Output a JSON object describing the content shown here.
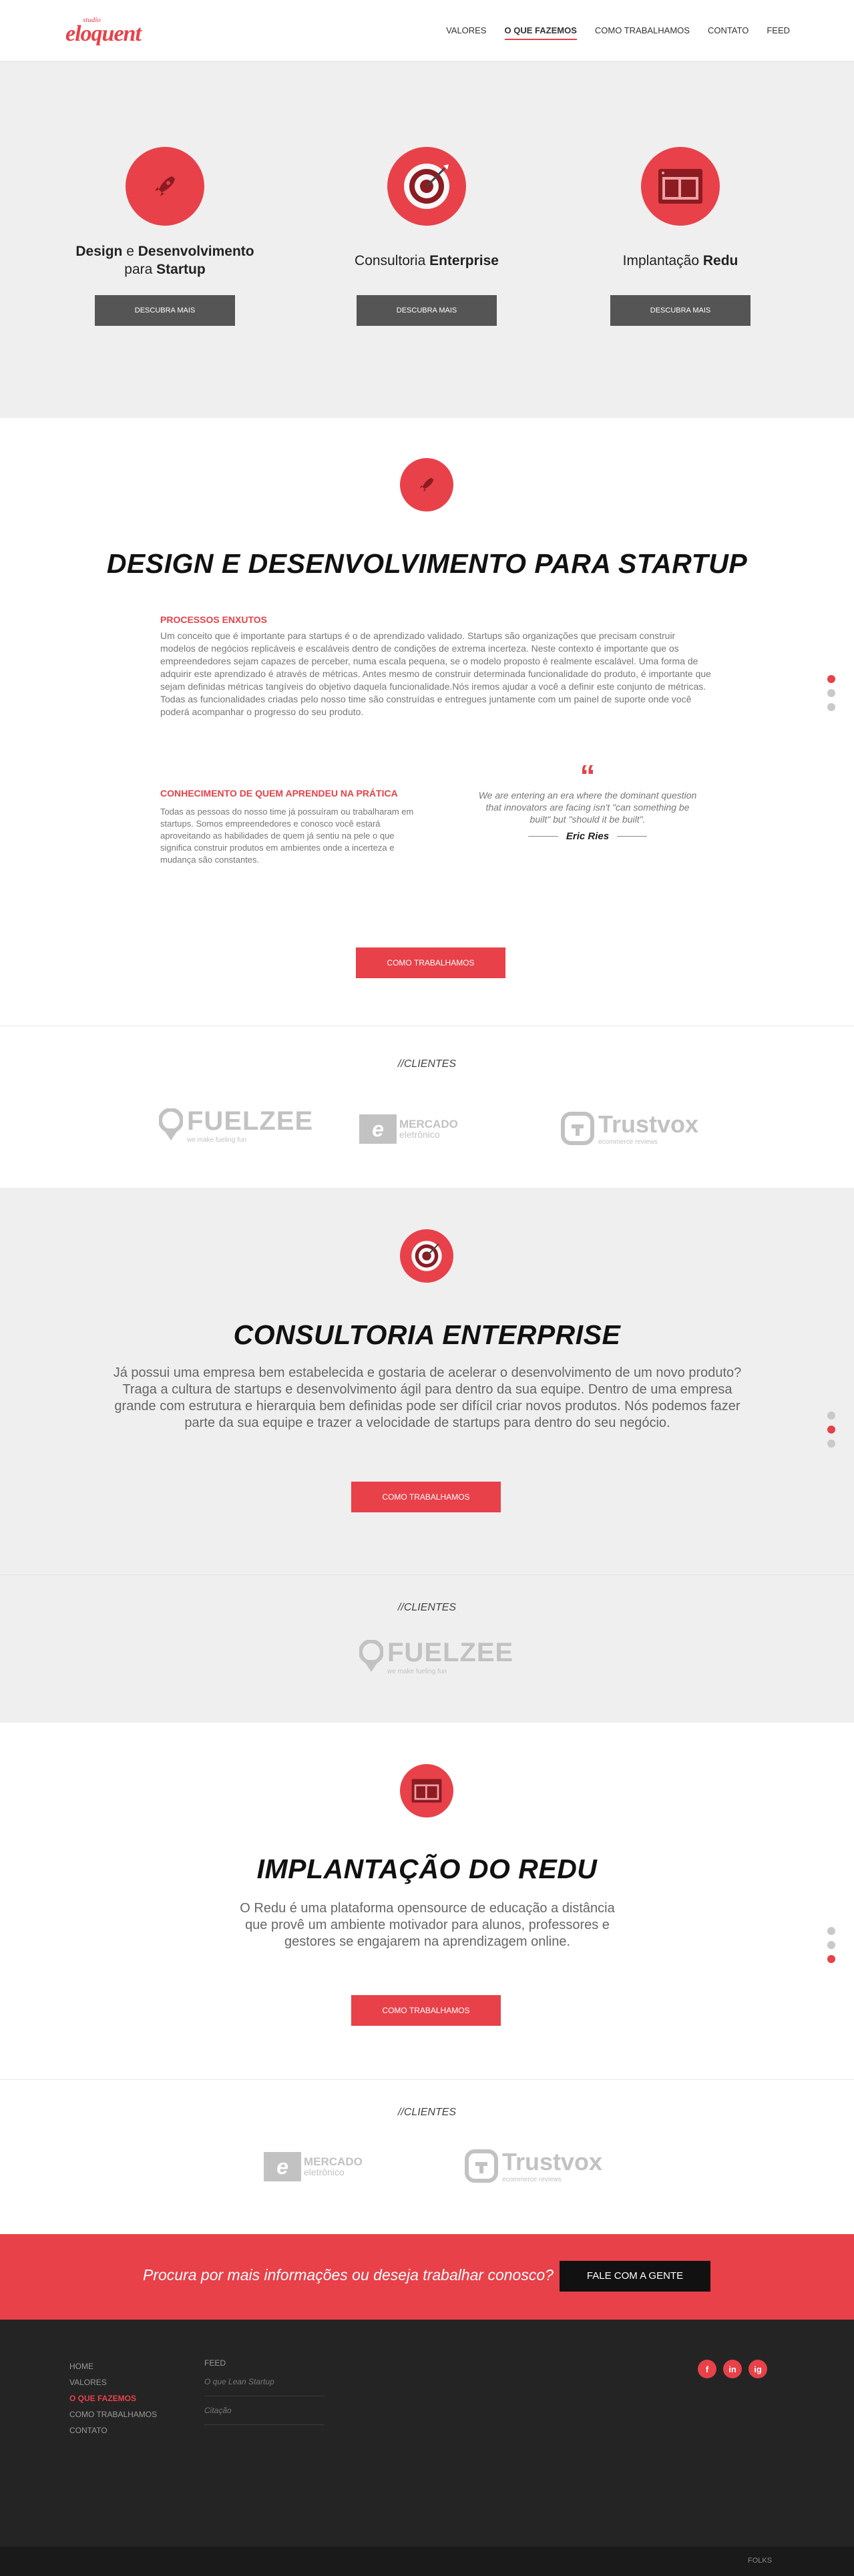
{
  "header": {
    "logo_small": "studio",
    "logo_main": "eloquent",
    "nav": [
      "Valores",
      "O que fazemos",
      "Como trabalhamos",
      "Contato",
      "Feed"
    ]
  },
  "services": {
    "items": [
      {
        "pre": "Design",
        "mid": " e ",
        "bold": "Desenvolvimento",
        "post": "para ",
        "post_bold": "Startup",
        "button": "Descubra mais"
      },
      {
        "plain": "Consultoria ",
        "bold": "Enterprise",
        "button": "Descubra mais"
      },
      {
        "plain": "Implantação ",
        "bold": "Redu",
        "button": "Descubra mais"
      }
    ]
  },
  "startup": {
    "title": "DESIGN E DESENVOLVIMENTO PARA STARTUP",
    "sub1": "Processos enxutos",
    "para1": "Um conceito que é importante para startups é o de aprendizado validado. Startups são organizações que precisam construir modelos de negócios replicáveis e escaláveis dentro de condições de extrema incerteza. Neste contexto é importante que os empreendedores sejam capazes de perceber, numa escala pequena, se o modelo proposto é realmente escalável. Uma forma de adquirir este aprendizado é através de métricas. Antes mesmo de construir determinada funcionalidade do produto, é importante que sejam definidas métricas tangíveis do objetivo daquela funcionalidade.Nós iremos ajudar a você a definir este conjunto de métricas. Todas as funcionalidades criadas pelo nosso time são construídas e entregues juntamente com um painel de suporte onde você poderá acompanhar o progresso do seu produto.",
    "sub2": "Conhecimento de quem aprendeu na prática",
    "para2": "Todas as pessoas do nosso time já possuíram ou trabalharam em startups. Somos empreendedores e conosco você estará aproveitando as habilidades de quem já sentiu na pele o que significa construir produtos em ambientes onde a incerteza e mudança são constantes.",
    "quote_mark": "“",
    "quote": "We are entering an era  where the dominant question that innovators are facing isn't \"can something be built\" but \"should it be built\".",
    "author": "Eric Ries",
    "button": "Como trabalhamos"
  },
  "clients1": {
    "title": "//CLIENTES"
  },
  "enterprise": {
    "title": "CONSULTORIA ENTERPRISE",
    "para": "Já possui uma empresa bem estabelecida e gostaria de acelerar o desenvolvimento de um novo produto? Traga a cultura de startups e desenvolvimento ágil para dentro da sua equipe. Dentro de uma empresa grande com estrutura e hierarquia bem definidas pode ser difícil criar novos produtos. Nós podemos fazer parte da sua equipe e trazer a velocidade de startups para dentro do seu negócio.",
    "button": "Como trabalhamos"
  },
  "clients2": {
    "title": "//CLIENTES"
  },
  "redu": {
    "title": "IMPLANTAÇÃO DO REDU",
    "para": "O Redu é uma plataforma opensource de educação a distância que provê um ambiente motivador para alunos, professores e gestores se engajarem na aprendizagem online.",
    "button": "Como trabalhamos"
  },
  "clients3": {
    "title": "//CLIENTES"
  },
  "logos": {
    "fuelzee": "FUELZEE",
    "fuelzee_tag": "we make fueling fun",
    "mercado_icon": "e",
    "mercado_1": "MERCADO",
    "mercado_2": "eletrônico",
    "trustvox": "Trustvox",
    "trustvox_tag": "ecommerce reviews"
  },
  "cta": {
    "text": "Procura por mais informações ou deseja trabalhar conosco?",
    "button": "Fale com a gente"
  },
  "footer": {
    "links": [
      "Home",
      "Valores",
      "O que fazemos",
      "Como trabalhamos",
      "Contato"
    ],
    "feed_title": "Feed",
    "feed_items": [
      "O que Lean Startup",
      "Citação"
    ],
    "social": [
      "f",
      "in",
      "ig"
    ],
    "bottom": "FOLKS"
  },
  "colors": {
    "accent": "#e84149",
    "dark": "#242424"
  }
}
